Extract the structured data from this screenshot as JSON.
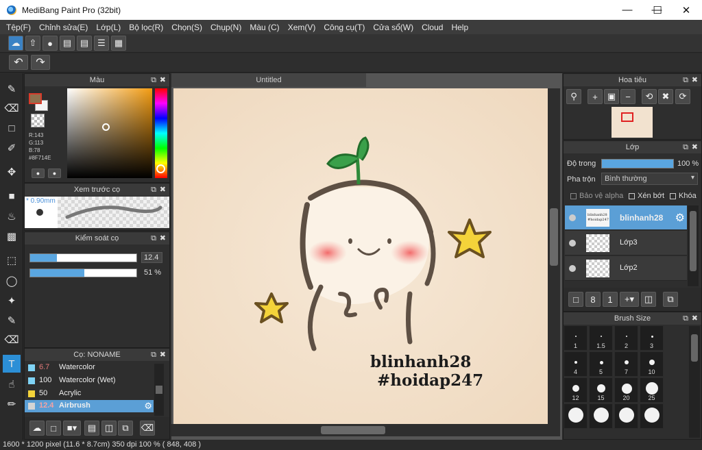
{
  "window": {
    "title": "MediBang Paint Pro (32bit)"
  },
  "menu": [
    "Tệp(F)",
    "Chỉnh sửa(E)",
    "Lớp(L)",
    "Bộ lọc(R)",
    "Chọn(S)",
    "Chụp(N)",
    "Màu (C)",
    "Xem(V)",
    "Công cụ(T)",
    "Cửa sổ(W)",
    "Cloud",
    "Help"
  ],
  "color_panel": {
    "title": "Màu",
    "r": "R:143",
    "g": "G:113",
    "b": "B:78",
    "hex": "#8F714E",
    "fg_color": "#8f714e"
  },
  "brush_preview": {
    "title": "Xem trước cọ",
    "size": "* 0.90mm"
  },
  "brush_control": {
    "title": "Kiểm soát cọ",
    "size_value": "12.4",
    "opacity_value": "51 %",
    "size_fraction": 0.25,
    "opacity_fraction": 0.51
  },
  "brush_panel": {
    "title": "Cọ: NONAME",
    "items": [
      {
        "size": "6.7",
        "name": "Watercolor",
        "color": "#7fd3f5"
      },
      {
        "size": "100",
        "name": "Watercolor (Wet)",
        "color": "#7fd3f5"
      },
      {
        "size": "50",
        "name": "Acrylic",
        "color": "#f4d33a"
      },
      {
        "size": "12.4",
        "name": "Airbrush",
        "color": "#d4d4d4"
      }
    ]
  },
  "document": {
    "tab": "Untitled"
  },
  "artwork": {
    "line1": "blinhanh28",
    "line2": "#hoidap247"
  },
  "navigator": {
    "title": "Hoa tiêu"
  },
  "layer_panel": {
    "title": "Lớp",
    "opacity_label": "Độ trong",
    "opacity_value": "100 %",
    "opacity_fraction": 1.0,
    "blend_label": "Pha trộn",
    "blend_value": "Bình thường",
    "protect_alpha": "Bảo vệ alpha",
    "clipping": "Xén bớt",
    "lock": "Khóa",
    "layers": [
      {
        "name": "blinhanh28"
      },
      {
        "name": "Lớp3"
      },
      {
        "name": "Lớp2"
      }
    ],
    "thumb_text_1": "blinhanh28",
    "thumb_text_2": "#hoidap247"
  },
  "brush_size_panel": {
    "title": "Brush Size",
    "sizes": [
      "1",
      "1.5",
      "2",
      "3",
      "4",
      "5",
      "7",
      "10",
      "12",
      "15",
      "20",
      "25"
    ]
  },
  "status": "1600 * 1200 pixel   (11.6 * 8.7cm)   350 dpi   100 %   ( 848, 408 )"
}
